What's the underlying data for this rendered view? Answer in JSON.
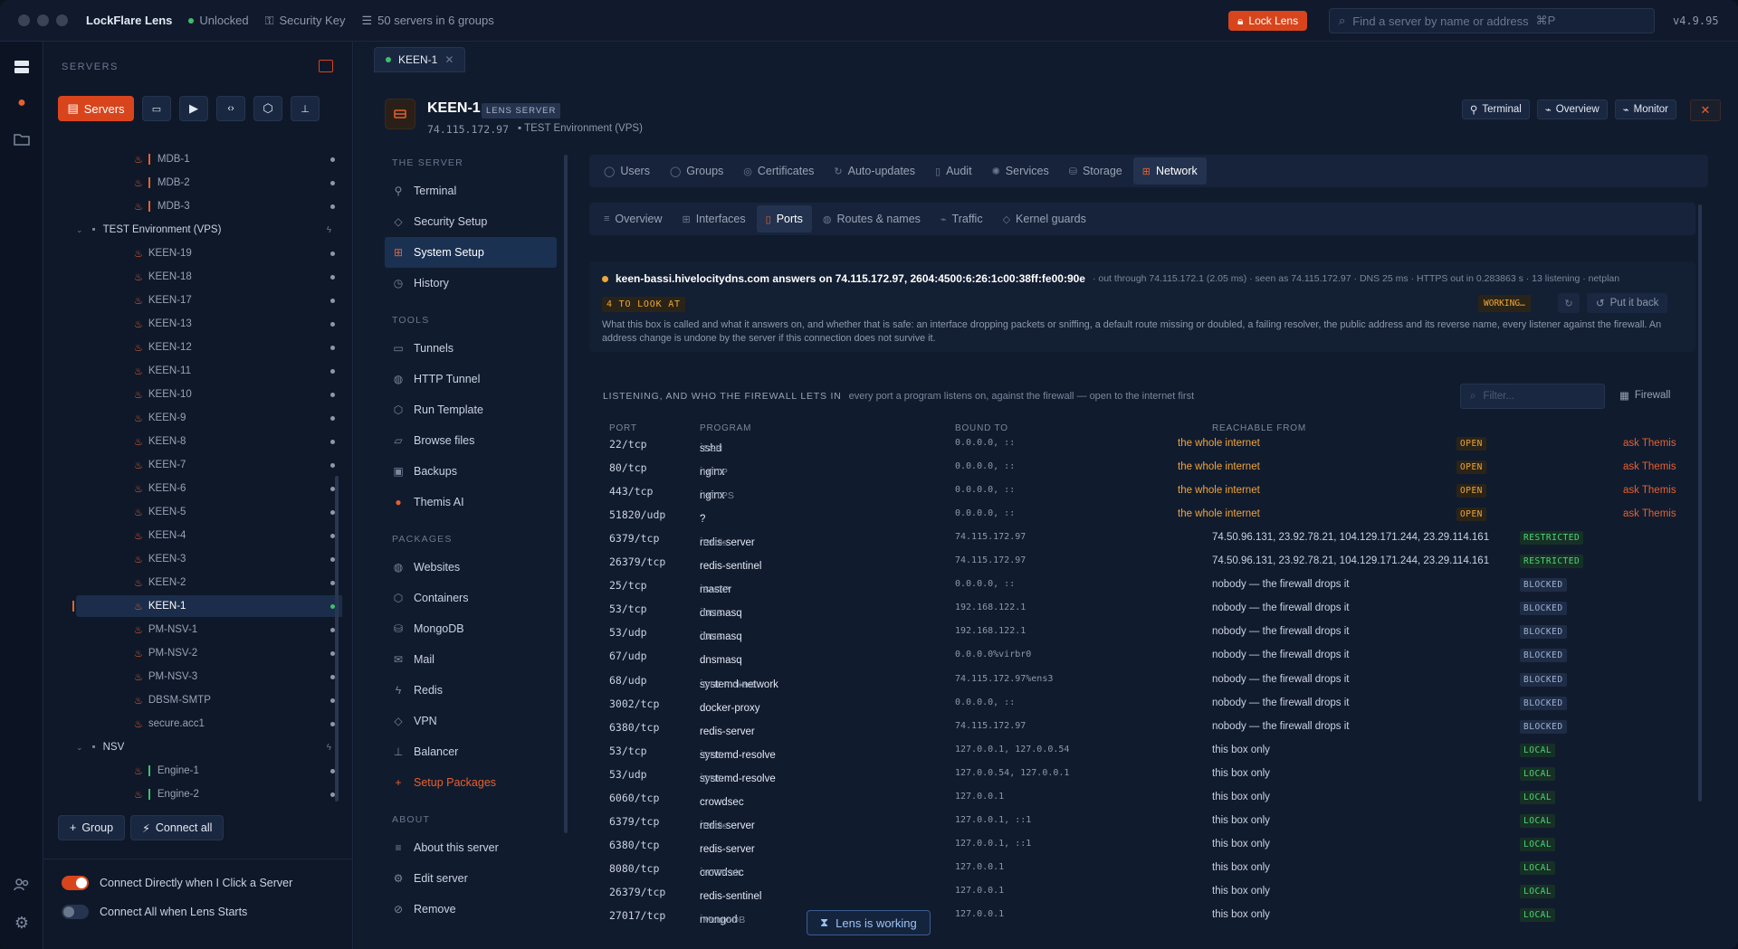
{
  "titlebar": {
    "app_name": "LockFlare Lens",
    "status": "Unlocked",
    "key": "Security Key",
    "servers_summary": "50 servers in 6 groups",
    "lock_button": "Lock Lens",
    "search_placeholder": "Find a server by name or address",
    "search_shortcut": "⌘P",
    "version": "v4.9.95"
  },
  "sidebar": {
    "heading": "SERVERS",
    "servers_button": "Servers",
    "tree": [
      {
        "type": "server",
        "label": "MDB-1",
        "bar": "#e5612f"
      },
      {
        "type": "server",
        "label": "MDB-2",
        "bar": "#e5612f"
      },
      {
        "type": "server",
        "label": "MDB-3",
        "bar": "#e5612f"
      },
      {
        "type": "group",
        "label": "TEST Environment (VPS)"
      },
      {
        "type": "server",
        "label": "KEEN-19"
      },
      {
        "type": "server",
        "label": "KEEN-18"
      },
      {
        "type": "server",
        "label": "KEEN-17"
      },
      {
        "type": "server",
        "label": "KEEN-13"
      },
      {
        "type": "server",
        "label": "KEEN-12"
      },
      {
        "type": "server",
        "label": "KEEN-11"
      },
      {
        "type": "server",
        "label": "KEEN-10"
      },
      {
        "type": "server",
        "label": "KEEN-9"
      },
      {
        "type": "server",
        "label": "KEEN-8"
      },
      {
        "type": "server",
        "label": "KEEN-7"
      },
      {
        "type": "server",
        "label": "KEEN-6"
      },
      {
        "type": "server",
        "label": "KEEN-5"
      },
      {
        "type": "server",
        "label": "KEEN-4"
      },
      {
        "type": "server",
        "label": "KEEN-3"
      },
      {
        "type": "server",
        "label": "KEEN-2"
      },
      {
        "type": "server",
        "label": "KEEN-1",
        "selected": true
      },
      {
        "type": "server",
        "label": "PM-NSV-1"
      },
      {
        "type": "server",
        "label": "PM-NSV-2"
      },
      {
        "type": "server",
        "label": "PM-NSV-3"
      },
      {
        "type": "server",
        "label": "DBSM-SMTP"
      },
      {
        "type": "server",
        "label": "secure.acc1"
      },
      {
        "type": "group",
        "label": "NSV"
      },
      {
        "type": "server",
        "label": "Engine-1",
        "bar": "#3fbf6a"
      },
      {
        "type": "server",
        "label": "Engine-2",
        "bar": "#3fbf6a"
      }
    ],
    "group_button": "Group",
    "connect_all_button": "Connect all",
    "toggle1": "Connect Directly when I Click a Server",
    "toggle2": "Connect All when Lens Starts"
  },
  "main": {
    "tab": "KEEN-1",
    "server_name": "KEEN-1",
    "server_badge": "LENS SERVER",
    "server_ip": "74.115.172.97",
    "server_group": "TEST Environment (VPS)",
    "header_buttons": [
      "Terminal",
      "Overview",
      "Monitor"
    ],
    "nav": {
      "section_server": "THE SERVER",
      "server_items": [
        "Terminal",
        "Security Setup",
        "System Setup",
        "History"
      ],
      "section_tools": "TOOLS",
      "tools_items": [
        "Tunnels",
        "HTTP Tunnel",
        "Run Template",
        "Browse files",
        "Backups",
        "Themis AI"
      ],
      "section_packages": "PACKAGES",
      "packages_items": [
        "Websites",
        "Containers",
        "MongoDB",
        "Mail",
        "Redis",
        "VPN",
        "Balancer",
        "Setup Packages"
      ],
      "section_about": "ABOUT",
      "about_items": [
        "About this server",
        "Edit server",
        "Remove"
      ]
    },
    "tabs": [
      "Users",
      "Groups",
      "Certificates",
      "Auto-updates",
      "Audit",
      "Services",
      "Storage",
      "Network"
    ],
    "subtabs": [
      "Overview",
      "Interfaces",
      "Ports",
      "Routes & names",
      "Traffic",
      "Kernel guards"
    ],
    "answer_line": "keen-bassi.hivelocitydns.com answers on 74.115.172.97, 2604:4500:6:26:1c00:38ff:fe00:90e",
    "answer_meta": "· out through 74.115.172.1 (2.05 ms) · seen as 74.115.172.97 · DNS 25 ms · HTTPS out in 0.283863 s · 13 listening · netplan",
    "look_badge": "4 TO LOOK AT",
    "working_badge": "WORKING…",
    "put_back": "Put it back",
    "description": "What this box is called and what it answers on, and whether that is safe: an interface dropping packets or sniffing, a default route missing or doubled, a failing resolver, the public address and its reverse name, every listener against the firewall. An address change is undone by the server if this connection does not survive it.",
    "listening_title": "LISTENING, AND WHO THE FIREWALL LETS IN",
    "listening_sub": "every port a program listens on, against the firewall — open to the internet first",
    "filter_placeholder": "Filter...",
    "firewall_button": "Firewall",
    "columns": [
      "PORT",
      "PROGRAM",
      "BOUND TO",
      "REACHABLE FROM"
    ],
    "ports": [
      {
        "port": "22/tcp",
        "prog": "sshd",
        "svc": "SSH",
        "bound": "0.0.0.0, ::",
        "reach": "the whole internet",
        "status": "OPEN",
        "ask": "ask Themis"
      },
      {
        "port": "80/tcp",
        "prog": "nginx",
        "svc": "HTTP",
        "bound": "0.0.0.0, ::",
        "reach": "the whole internet",
        "status": "OPEN",
        "ask": "ask Themis"
      },
      {
        "port": "443/tcp",
        "prog": "nginx",
        "svc": "HTTPS",
        "bound": "0.0.0.0, ::",
        "reach": "the whole internet",
        "status": "OPEN",
        "ask": "ask Themis"
      },
      {
        "port": "51820/udp",
        "prog": "?",
        "svc": "",
        "bound": "0.0.0.0, ::",
        "reach": "the whole internet",
        "status": "OPEN",
        "ask": "ask Themis"
      },
      {
        "port": "6379/tcp",
        "prog": "redis-server",
        "svc": "Redis",
        "bound": "74.115.172.97",
        "reach": "74.50.96.131, 23.92.78.21, 104.129.171.244, 23.29.114.161",
        "status": "RESTRICTED"
      },
      {
        "port": "26379/tcp",
        "prog": "redis-sentinel",
        "svc": "",
        "bound": "74.115.172.97",
        "reach": "74.50.96.131, 23.92.78.21, 104.129.171.244, 23.29.114.161",
        "status": "RESTRICTED"
      },
      {
        "port": "25/tcp",
        "prog": "master",
        "svc": "SMTP",
        "bound": "0.0.0.0, ::",
        "reach": "nobody — the firewall drops it",
        "status": "BLOCKED"
      },
      {
        "port": "53/tcp",
        "prog": "dnsmasq",
        "svc": "DNS",
        "bound": "192.168.122.1",
        "reach": "nobody — the firewall drops it",
        "status": "BLOCKED"
      },
      {
        "port": "53/udp",
        "prog": "dnsmasq",
        "svc": "DNS",
        "bound": "192.168.122.1",
        "reach": "nobody — the firewall drops it",
        "status": "BLOCKED"
      },
      {
        "port": "67/udp",
        "prog": "dnsmasq",
        "svc": "",
        "bound": "0.0.0.0%virbr0",
        "reach": "nobody — the firewall drops it",
        "status": "BLOCKED"
      },
      {
        "port": "68/udp",
        "prog": "systemd-network",
        "svc": "DHCP client",
        "bound": "74.115.172.97%ens3",
        "reach": "nobody — the firewall drops it",
        "status": "BLOCKED"
      },
      {
        "port": "3002/tcp",
        "prog": "docker-proxy",
        "svc": "",
        "bound": "0.0.0.0, ::",
        "reach": "nobody — the firewall drops it",
        "status": "BLOCKED"
      },
      {
        "port": "6380/tcp",
        "prog": "redis-server",
        "svc": "",
        "bound": "74.115.172.97",
        "reach": "nobody — the firewall drops it",
        "status": "BLOCKED"
      },
      {
        "port": "53/tcp",
        "prog": "systemd-resolve",
        "svc": "DNS",
        "bound": "127.0.0.1, 127.0.0.54",
        "reach": "this box only",
        "status": "LOCAL"
      },
      {
        "port": "53/udp",
        "prog": "systemd-resolve",
        "svc": "DNS",
        "bound": "127.0.0.54, 127.0.0.1",
        "reach": "this box only",
        "status": "LOCAL"
      },
      {
        "port": "6060/tcp",
        "prog": "crowdsec",
        "svc": "",
        "bound": "127.0.0.1",
        "reach": "this box only",
        "status": "LOCAL"
      },
      {
        "port": "6379/tcp",
        "prog": "redis-server",
        "svc": "Redis",
        "bound": "127.0.0.1, ::1",
        "reach": "this box only",
        "status": "LOCAL"
      },
      {
        "port": "6380/tcp",
        "prog": "redis-server",
        "svc": "",
        "bound": "127.0.0.1, ::1",
        "reach": "this box only",
        "status": "LOCAL"
      },
      {
        "port": "8080/tcp",
        "prog": "crowdsec",
        "svc": "HTTP alt",
        "bound": "127.0.0.1",
        "reach": "this box only",
        "status": "LOCAL"
      },
      {
        "port": "26379/tcp",
        "prog": "redis-sentinel",
        "svc": "",
        "bound": "127.0.0.1",
        "reach": "this box only",
        "status": "LOCAL"
      },
      {
        "port": "27017/tcp",
        "prog": "mongod",
        "svc": "MongoDB",
        "bound": "127.0.0.1",
        "reach": "this box only",
        "status": "LOCAL"
      }
    ],
    "toast": "Lens is working"
  }
}
